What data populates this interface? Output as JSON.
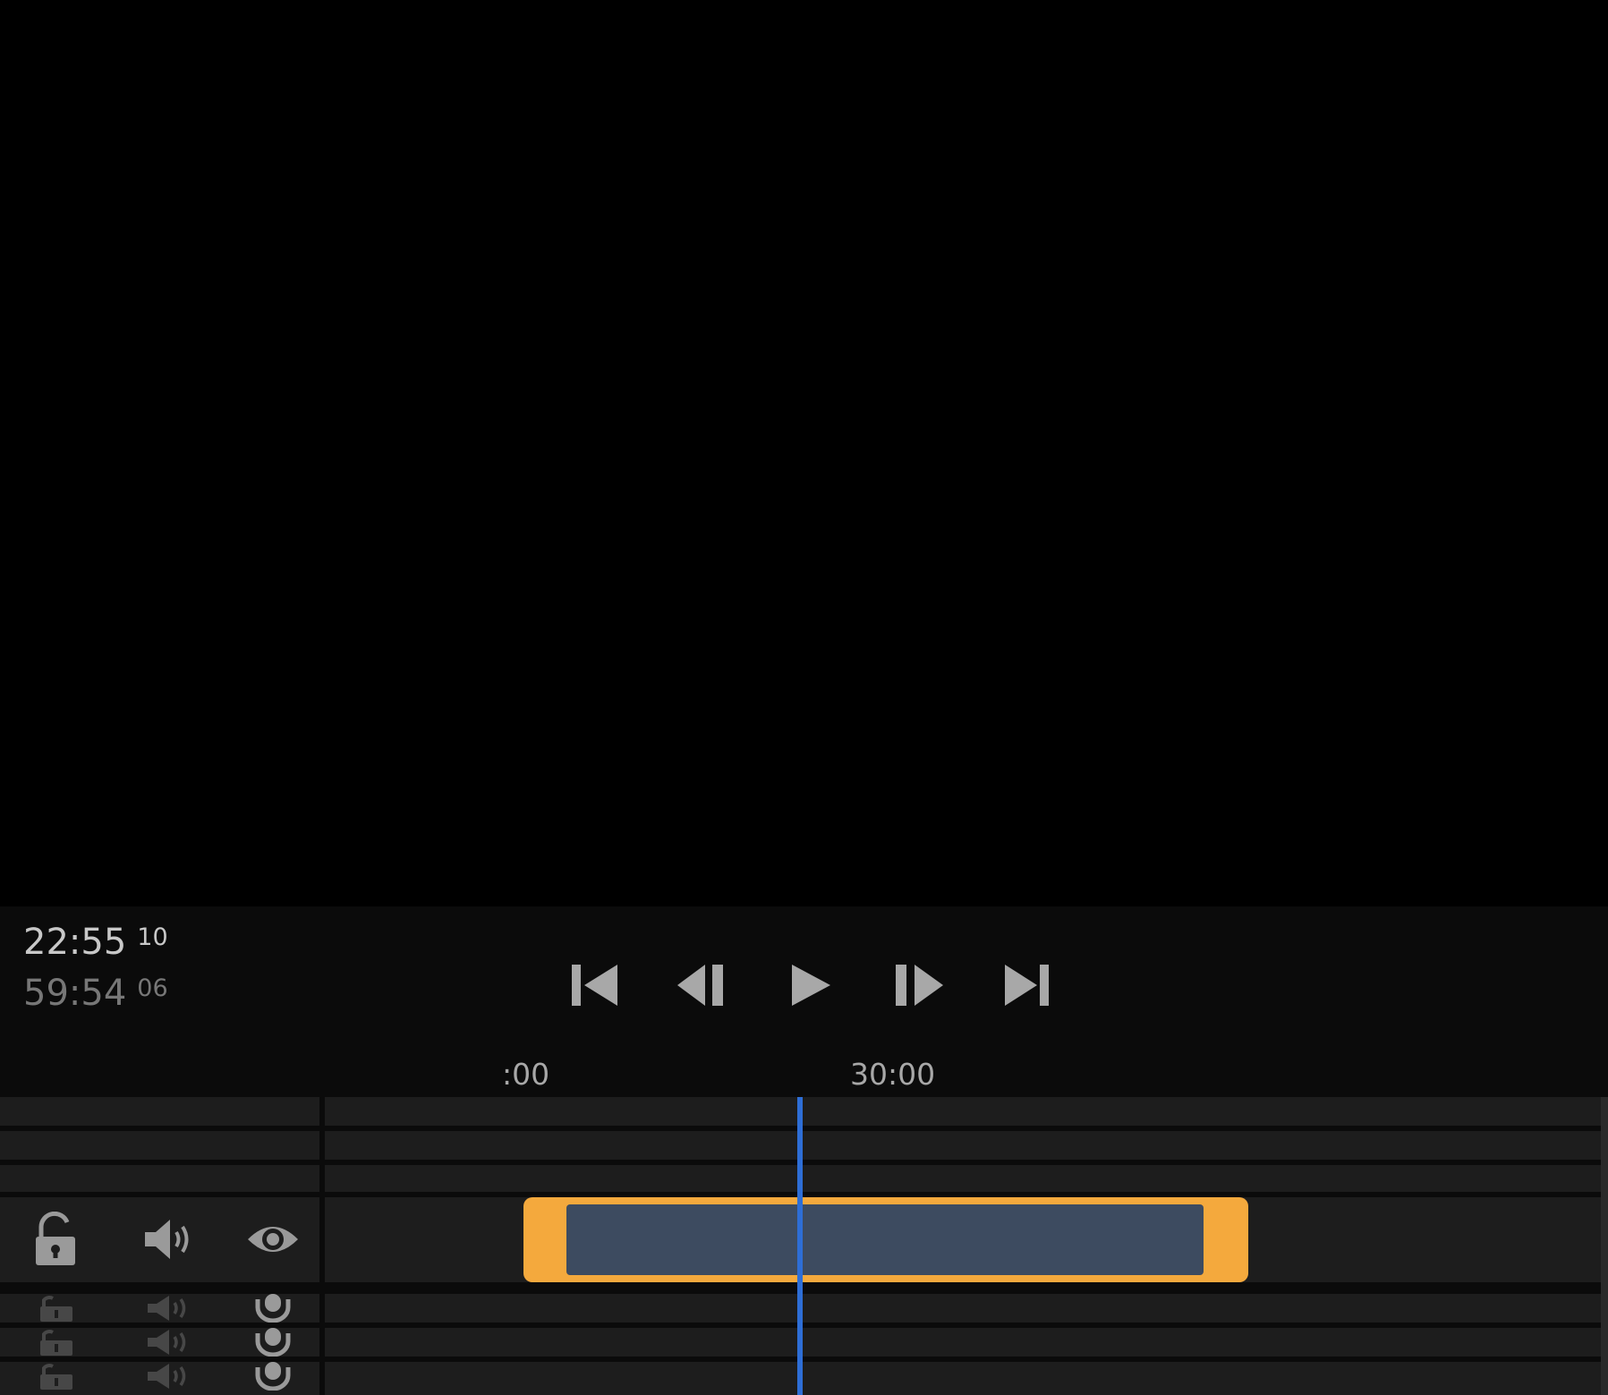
{
  "viewer": {
    "background": "#000000"
  },
  "timecode": {
    "current": {
      "main": "22:55",
      "frames": "10"
    },
    "duration": {
      "main": "59:54",
      "frames": "06"
    }
  },
  "transport": {
    "buttons": [
      {
        "name": "skip-to-start",
        "icon": "skip-start-icon"
      },
      {
        "name": "step-back",
        "icon": "step-back-icon"
      },
      {
        "name": "play",
        "icon": "play-icon"
      },
      {
        "name": "step-forward",
        "icon": "step-forward-icon"
      },
      {
        "name": "skip-to-end",
        "icon": "skip-end-icon"
      }
    ]
  },
  "ruler": {
    "labels": [
      ":00",
      "30:00"
    ]
  },
  "tracks": {
    "video_track_icons": [
      "unlock-icon",
      "volume-icon",
      "eye-icon"
    ],
    "audio_track_icons": [
      "unlock-icon",
      "volume-icon",
      "microphone-icon"
    ]
  },
  "clip": {
    "frame_color": "#f4a93d",
    "body_color": "#3d4b60"
  },
  "playhead": {
    "color": "#2e6ed6"
  }
}
